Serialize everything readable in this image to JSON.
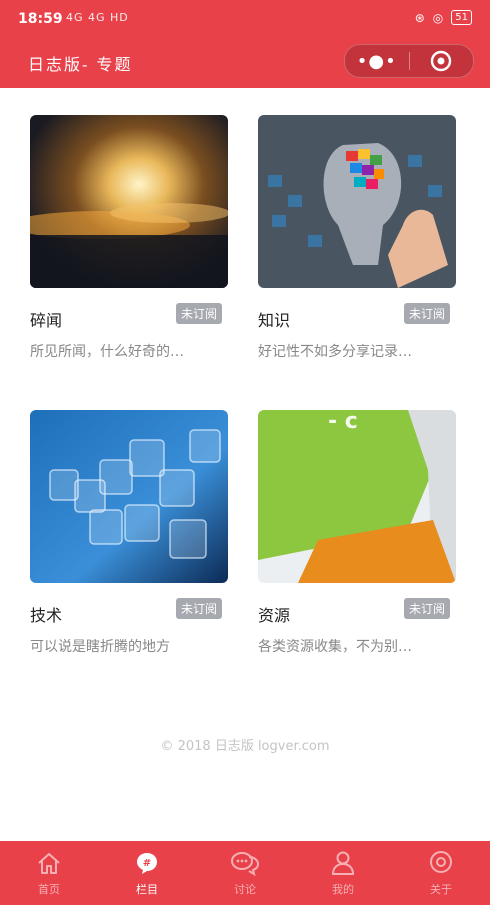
{
  "status": {
    "time": "18:59",
    "signal": "4G 4G HD",
    "battery": "51"
  },
  "header": {
    "title": "日志版- 专题"
  },
  "cards": [
    {
      "name": "碎闻",
      "badge": "未订阅",
      "desc": "所见所闻，什么好奇的…"
    },
    {
      "name": "知识",
      "badge": "未订阅",
      "desc": "好记性不如多分享记录…"
    },
    {
      "name": "技术",
      "badge": "未订阅",
      "desc": "可以说是瞎折腾的地方"
    },
    {
      "name": "资源",
      "badge": "未订阅",
      "desc": "各类资源收集，不为别…"
    }
  ],
  "footer": {
    "copyright": "© 2018 日志版 logver.com"
  },
  "tabs": [
    {
      "label": "首页",
      "icon": "home-icon"
    },
    {
      "label": "栏目",
      "icon": "category-icon"
    },
    {
      "label": "讨论",
      "icon": "chat-icon"
    },
    {
      "label": "我的",
      "icon": "user-icon"
    },
    {
      "label": "关于",
      "icon": "about-icon"
    }
  ],
  "colors": {
    "brand": "#e8414a",
    "badge": "#a7a9b0"
  }
}
